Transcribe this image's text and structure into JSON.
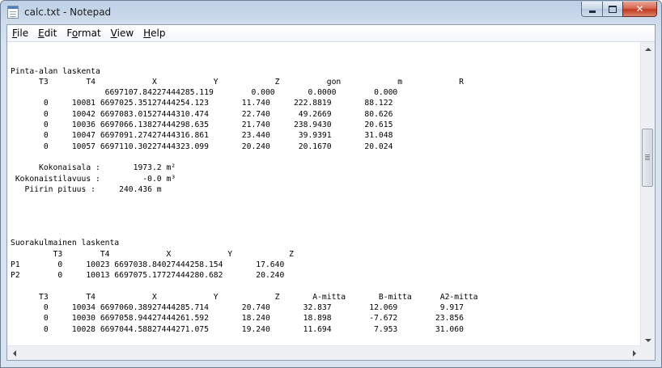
{
  "window": {
    "title": "calc.txt - Notepad",
    "icons": {
      "app": "notepad-icon",
      "minimize": "minimize-icon",
      "maximize": "maximize-icon",
      "close": "close-icon"
    },
    "close_glyph": "✕"
  },
  "menu": {
    "items": [
      {
        "accel": "F",
        "rest": "ile"
      },
      {
        "accel": "E",
        "rest": "dit"
      },
      {
        "accel": "o",
        "pre": "F",
        "rest": "rmat"
      },
      {
        "accel": "V",
        "rest": "iew"
      },
      {
        "accel": "H",
        "rest": "elp"
      }
    ]
  },
  "document": {
    "lines": [
      "",
      "",
      "Pinta-alan laskenta",
      "      T3        T4            X            Y            Z          gon            m            R",
      "                    6697107.84227444285.119        0.000       0.0000        0.000",
      "       0     10081 6697025.35127444254.123       11.740     222.8819       88.122",
      "       0     10042 6697083.01527444310.474       22.740      49.2669       80.626",
      "       0     10036 6697066.13827444298.635       21.740     238.9430       20.615",
      "       0     10047 6697091.27427444316.861       23.440      39.9391       31.048",
      "       0     10057 6697110.30227444323.099       20.240      20.1670       20.024",
      "",
      "      Kokonaisala :       1973.2 m²",
      " Kokonaistilavuus :         -0.0 m³",
      "   Piirin pituus :     240.436 m",
      "",
      "",
      "",
      "",
      "Suorakulmainen laskenta",
      "         T3        T4            X            Y            Z",
      "P1        0     10023 6697038.84027444258.154       17.640",
      "P2        0     10013 6697075.17727444280.682       20.240",
      "",
      "      T3        T4            X            Y            Z       A-mitta       B-mitta      A2-mitta",
      "       0     10034 6697060.38927444285.714       20.740       32.837        12.069         9.917",
      "       0     10030 6697058.94427444261.592       18.240       18.898        -7.672        23.856",
      "       0     10028 6697044.58827444271.075       19.240       11.694         7.953        31.060"
    ]
  }
}
